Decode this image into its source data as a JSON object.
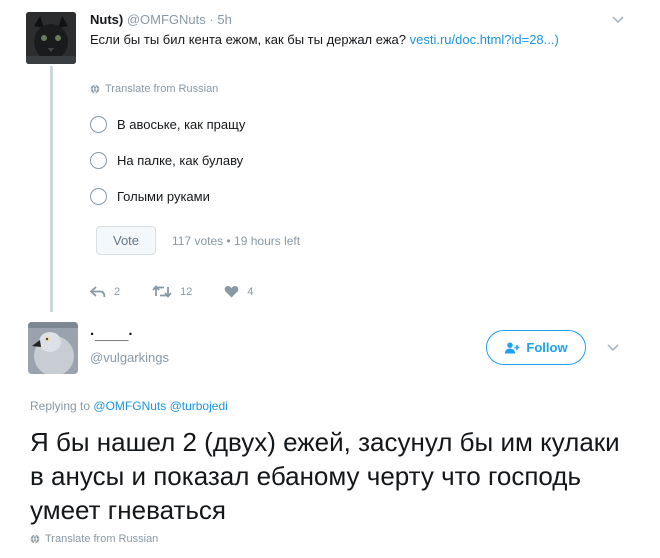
{
  "tweet1": {
    "author_name": "Nuts)",
    "author_handle": "@OMFGNuts",
    "separator": "·",
    "time": "5h",
    "text": "Если бы ты бил кента ежом, как бы ты держал ежа? ",
    "link": "vesti.ru/doc.html?id=28...)",
    "translate": "Translate from Russian",
    "poll": {
      "options": [
        "В авоське, как пращу",
        "На палке, как булаву",
        "Голыми руками"
      ],
      "vote_label": "Vote",
      "votes": "117 votes",
      "dot": "•",
      "time_left": "19 hours left"
    },
    "actions": {
      "replies": "2",
      "retweets": "12",
      "likes": "4"
    }
  },
  "tweet2": {
    "author_name": "·____·",
    "author_handle": "@vulgarkings",
    "follow_label": "Follow",
    "replying_to_label": "Replying to",
    "replying_to_users": "@OMFGNuts @turbojedi",
    "text": "Я бы нашел 2 (двух) ежей, засунул бы им кулаки в анусы и показал ебаному черту что господь умеет гневаться",
    "translate": "Translate from Russian"
  },
  "colors": {
    "link": "#1b95e0",
    "follow": "#1da1f2",
    "muted": "#8899a6",
    "text": "#14171a"
  }
}
